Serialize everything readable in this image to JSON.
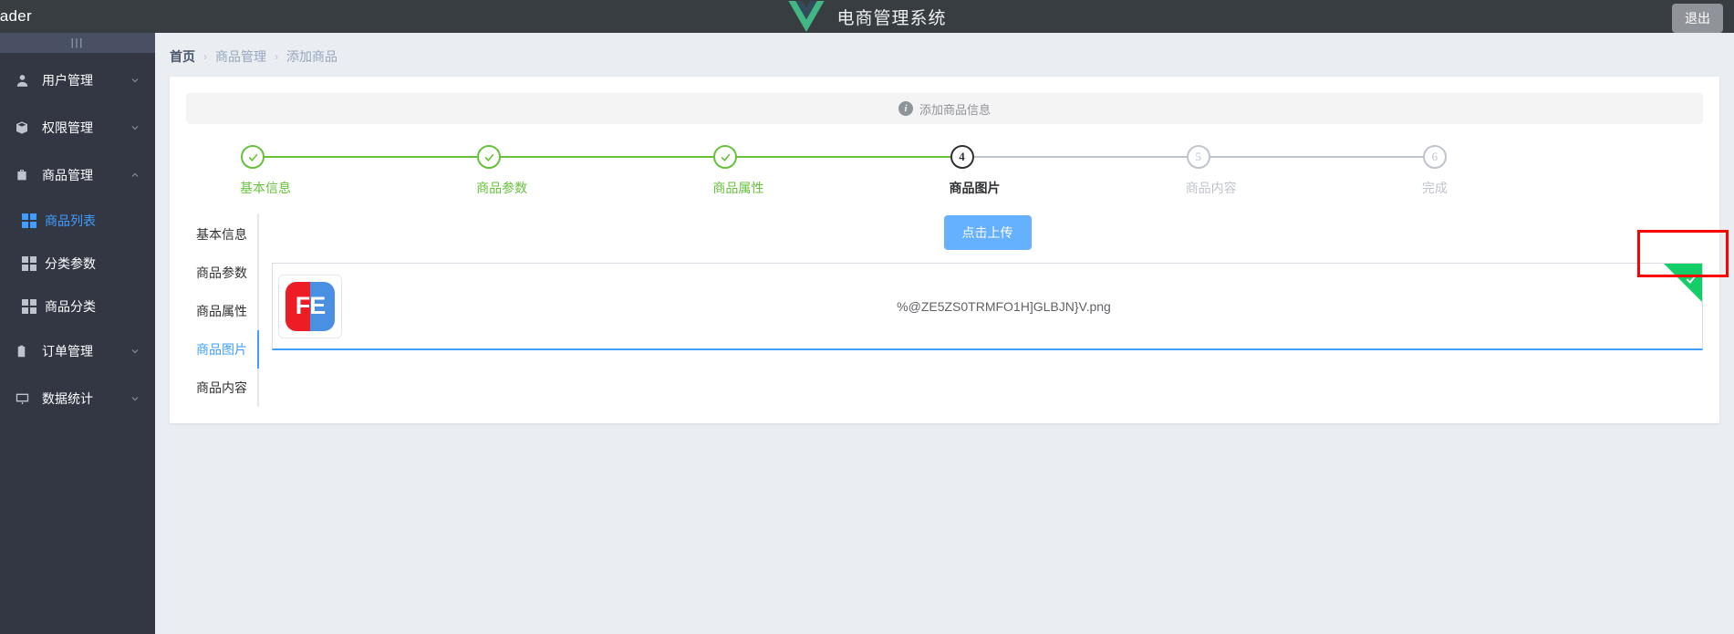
{
  "header": {
    "left_label": "eader",
    "title": "电商管理系统",
    "logo_icon": "vue-logo-icon",
    "logout_label": "退出"
  },
  "sidebar": {
    "toggle_label": "|||",
    "groups": [
      {
        "label": "用户管理",
        "icon": "user-icon",
        "expanded": false,
        "children": []
      },
      {
        "label": "权限管理",
        "icon": "box-icon",
        "expanded": false,
        "children": []
      },
      {
        "label": "商品管理",
        "icon": "briefcase-icon",
        "expanded": true,
        "children": [
          {
            "label": "商品列表",
            "icon": "grid-icon",
            "active": true
          },
          {
            "label": "分类参数",
            "icon": "grid-icon",
            "active": false
          },
          {
            "label": "商品分类",
            "icon": "grid-icon",
            "active": false
          }
        ]
      },
      {
        "label": "订单管理",
        "icon": "clipboard-icon",
        "expanded": false,
        "children": []
      },
      {
        "label": "数据统计",
        "icon": "chart-icon",
        "expanded": false,
        "children": []
      }
    ]
  },
  "breadcrumb": {
    "items": [
      "首页",
      "商品管理",
      "添加商品"
    ],
    "separator": "›"
  },
  "alert": {
    "icon": "info-icon",
    "text": "添加商品信息"
  },
  "steps": [
    {
      "index": "1",
      "label": "基本信息",
      "status": "done"
    },
    {
      "index": "2",
      "label": "商品参数",
      "status": "done"
    },
    {
      "index": "3",
      "label": "商品属性",
      "status": "done"
    },
    {
      "index": "4",
      "label": "商品图片",
      "status": "active"
    },
    {
      "index": "5",
      "label": "商品内容",
      "status": "pending"
    },
    {
      "index": "6",
      "label": "完成",
      "status": "pending"
    }
  ],
  "tabs": [
    {
      "label": "基本信息",
      "active": false
    },
    {
      "label": "商品参数",
      "active": false
    },
    {
      "label": "商品属性",
      "active": false
    },
    {
      "label": "商品图片",
      "active": true
    },
    {
      "label": "商品内容",
      "active": false
    }
  ],
  "upload": {
    "button_label": "点击上传",
    "file": {
      "name": "%@ZE5ZS0TRMFO1H]GLBJN}V.png",
      "thumbnail_text": "FE",
      "status": "success",
      "status_icon": "check-icon"
    }
  },
  "annotation": {
    "type": "red-highlight-box",
    "target": "upload-success-corner"
  },
  "colors": {
    "header_bg": "#373d41",
    "sidebar_bg": "#333744",
    "accent_blue": "#409eff",
    "success_green": "#67c23a",
    "corner_green": "#13ce66",
    "highlight_red": "#ff0000",
    "main_bg": "#eaedf1"
  }
}
